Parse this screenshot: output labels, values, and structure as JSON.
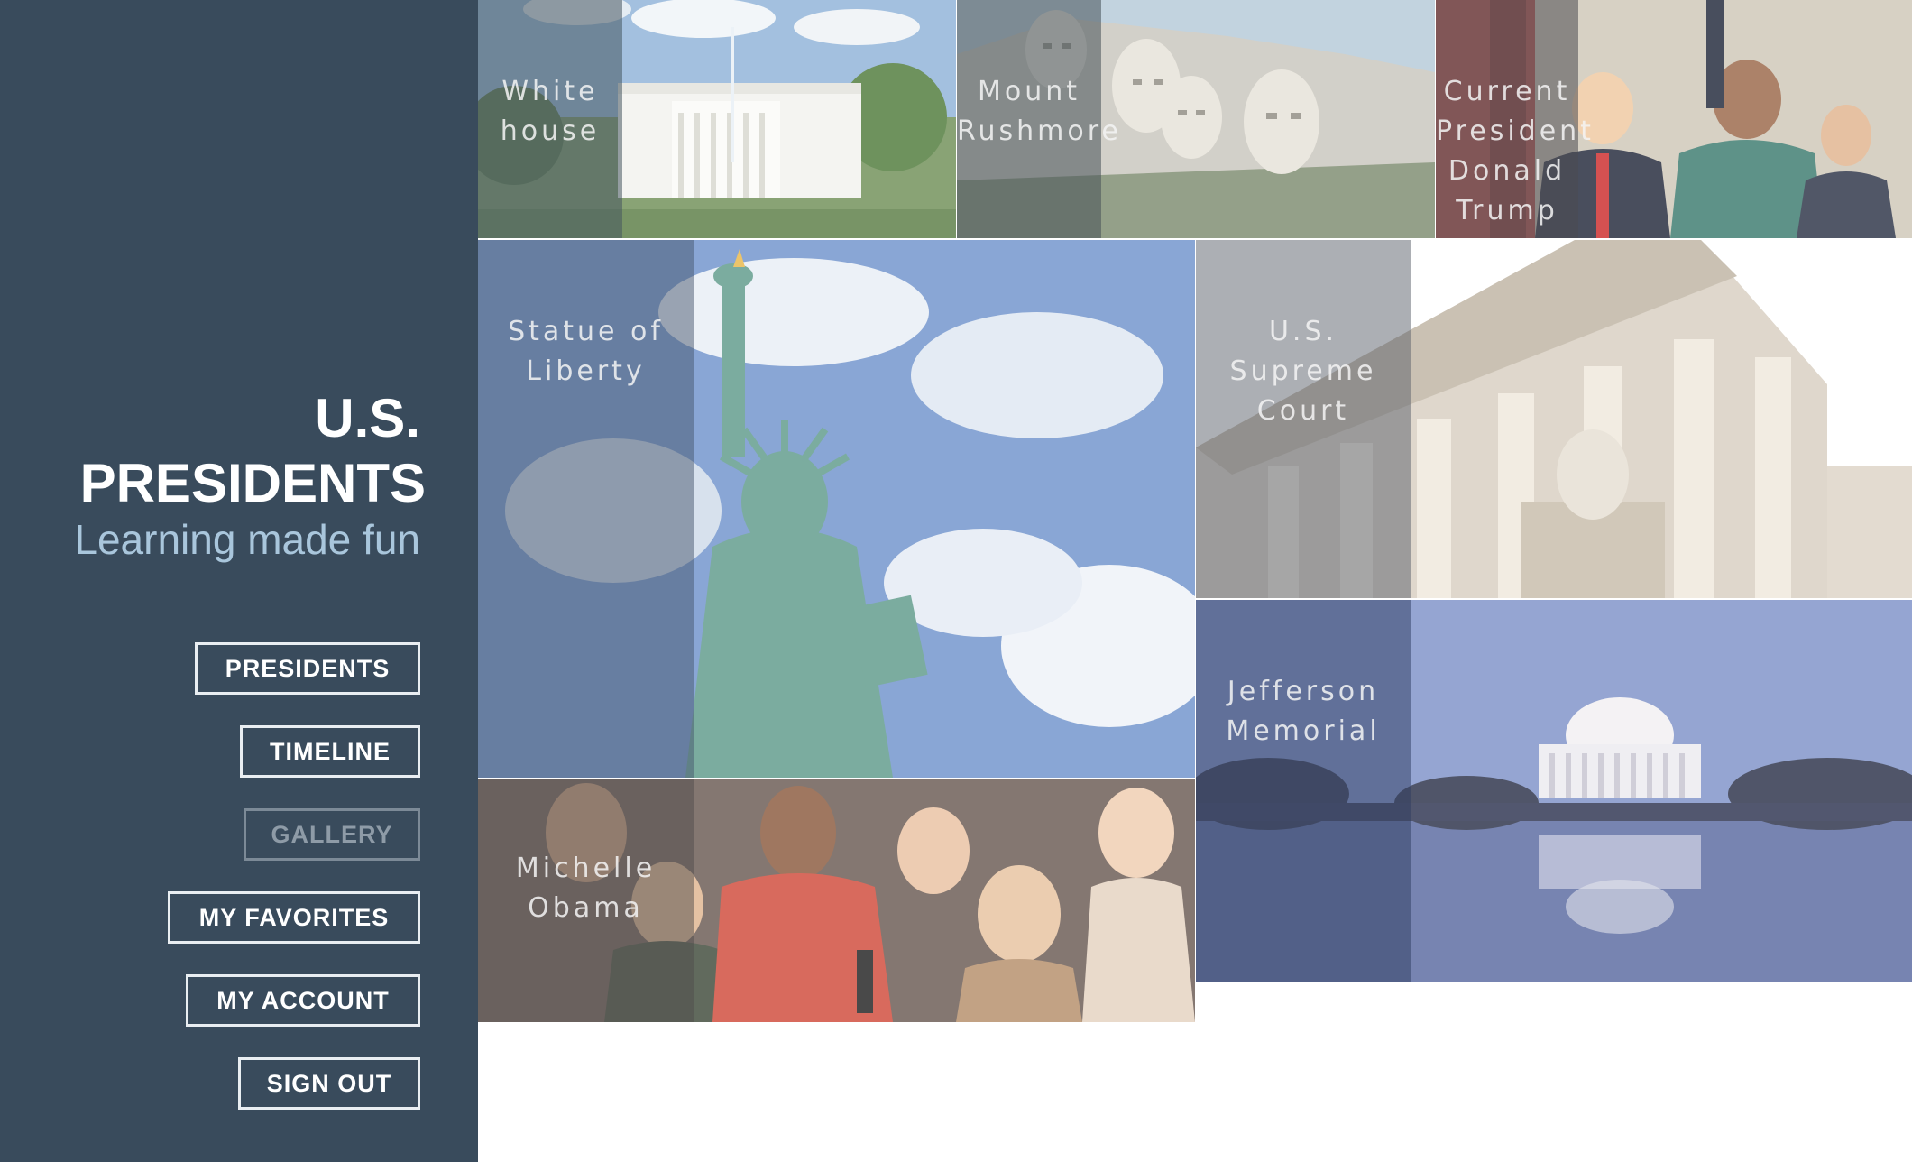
{
  "brand": {
    "title_line1": "U.S.",
    "title_line2": "PRESIDENTS",
    "tagline": "Learning made fun"
  },
  "nav": {
    "presidents": "PRESIDENTS",
    "timeline": "TIMELINE",
    "gallery": "GALLERY",
    "favorites": "MY FAVORITES",
    "account": "MY ACCOUNT",
    "signout": "SIGN OUT"
  },
  "gallery": {
    "white_house": "White\nhouse",
    "mount_rushmore": "Mount\nRushmore",
    "current_president": "Current\nPresident\nDonald\nTrump",
    "statue_of_liberty": "Statue of\nLiberty",
    "supreme_court": "U.S.\nSupreme\nCourt",
    "jefferson_memorial": "Jefferson\nMemorial",
    "michelle_obama": "Michelle\nObama"
  },
  "colors": {
    "sidebar_bg": "#394b5c",
    "tagline": "#a9c6dc",
    "active_nav_border": "#e9eef2",
    "inactive_nav": "#8e9ba7"
  }
}
